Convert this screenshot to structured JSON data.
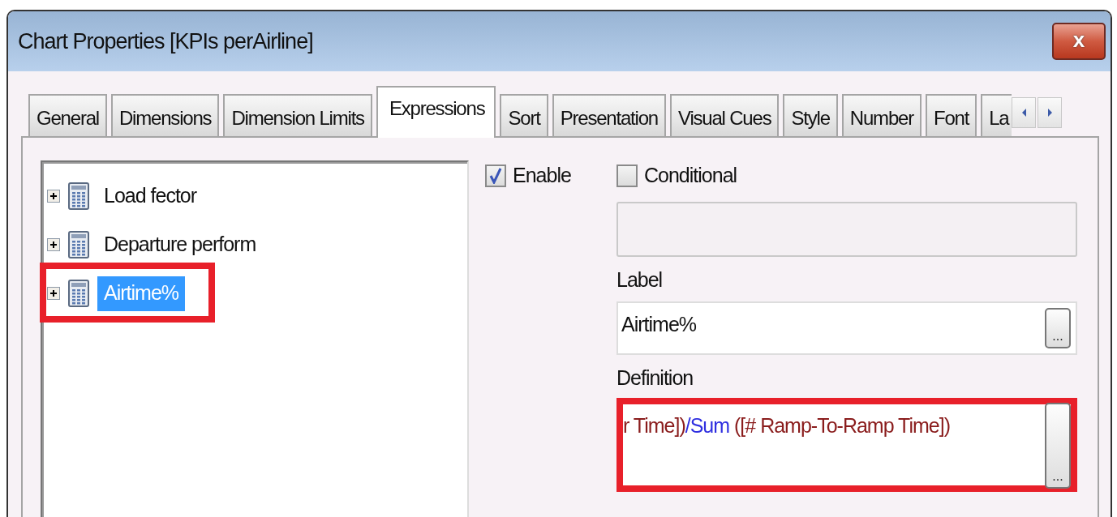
{
  "window": {
    "title": "Chart Properties [KPIs perAirline]",
    "close": "x"
  },
  "tabs": [
    {
      "label": "General",
      "selected": false
    },
    {
      "label": "Dimensions",
      "selected": false
    },
    {
      "label": "Dimension Limits",
      "selected": false
    },
    {
      "label": "Expressions",
      "selected": true
    },
    {
      "label": "Sort",
      "selected": false
    },
    {
      "label": "Presentation",
      "selected": false
    },
    {
      "label": "Visual Cues",
      "selected": false
    },
    {
      "label": "Style",
      "selected": false
    },
    {
      "label": "Number",
      "selected": false
    },
    {
      "label": "Font",
      "selected": false
    },
    {
      "label": "La",
      "selected": false
    }
  ],
  "expressions": [
    {
      "label": "Load fector",
      "selected": false,
      "highlighted": false
    },
    {
      "label": "Departure perform",
      "selected": false,
      "highlighted": false
    },
    {
      "label": "Airtime%",
      "selected": true,
      "highlighted": true
    }
  ],
  "enable": {
    "label": "Enable",
    "checked": true
  },
  "conditional": {
    "label": "Conditional",
    "checked": false
  },
  "label_field": {
    "caption": "Label",
    "value": "Airtime%",
    "button": "..."
  },
  "definition": {
    "caption": "Definition",
    "highlighted": true,
    "button": "...",
    "tokens": [
      {
        "text": "r Time])",
        "kind": "field"
      },
      {
        "text": "/Sum",
        "kind": "function"
      },
      {
        "text": " ([# Ramp-To-Ramp Time])",
        "kind": "field"
      }
    ]
  }
}
